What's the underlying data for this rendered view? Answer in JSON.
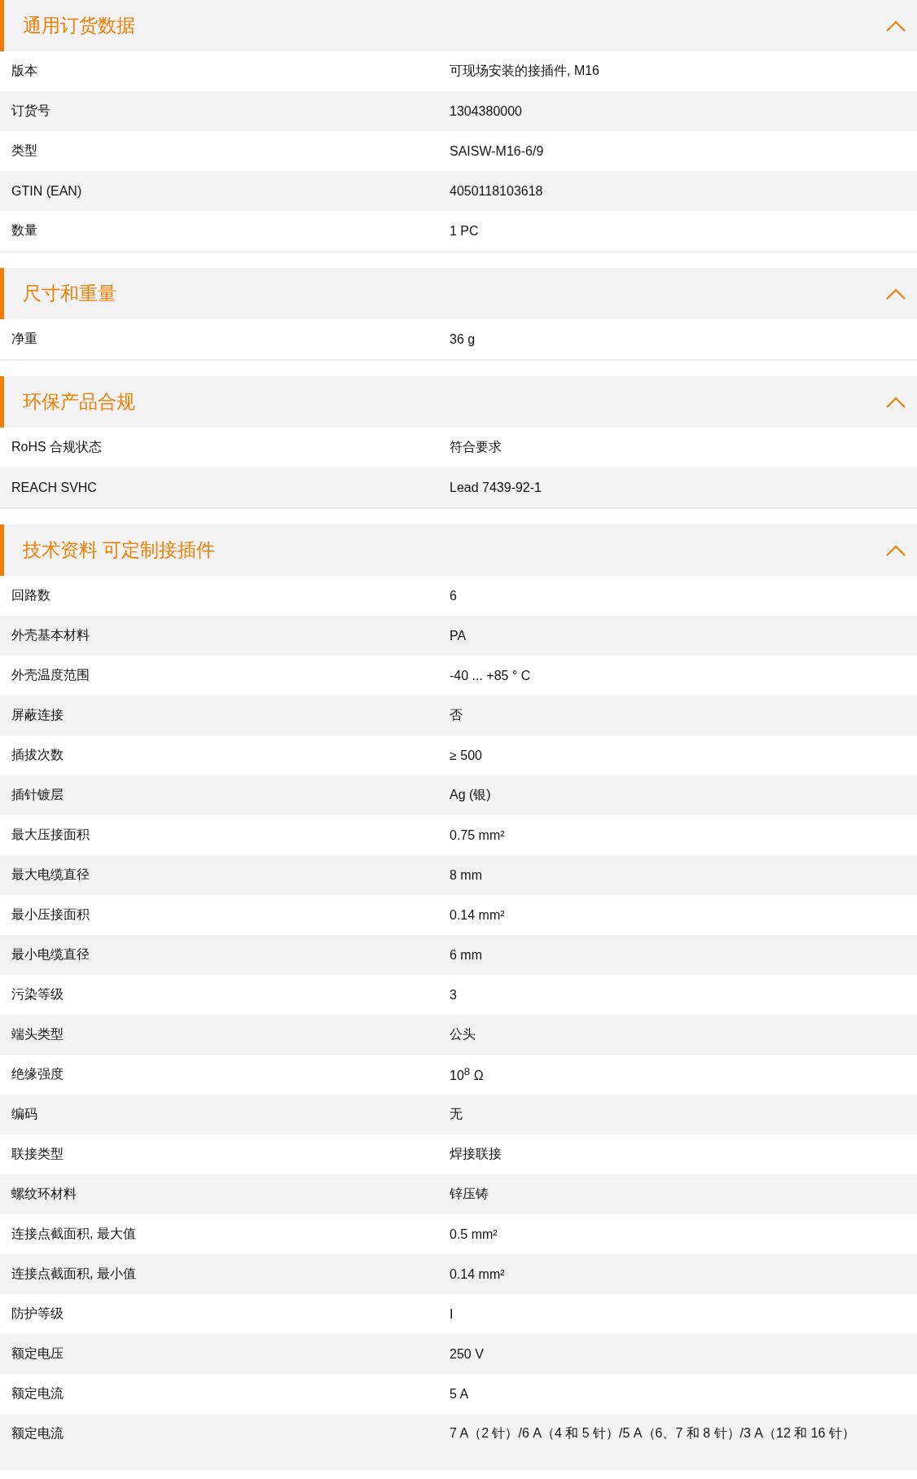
{
  "sections": [
    {
      "title": "通用订货数据",
      "expanded": true,
      "rows": [
        {
          "label": "版本",
          "value": "可现场安装的接插件, M16"
        },
        {
          "label": "订货号",
          "value": "1304380000"
        },
        {
          "label": "类型",
          "value": "SAISW-M16-6/9"
        },
        {
          "label": "GTIN (EAN)",
          "value": "4050118103618"
        },
        {
          "label": "数量",
          "value": "1  PC"
        }
      ]
    },
    {
      "title": "尺寸和重量",
      "expanded": true,
      "rows": [
        {
          "label": "净重",
          "value": "36  g"
        }
      ]
    },
    {
      "title": "环保产品合规",
      "expanded": true,
      "rows": [
        {
          "label": "RoHS 合规状态",
          "value": "符合要求"
        },
        {
          "label": "REACH SVHC",
          "value": "Lead 7439-92-1"
        }
      ]
    },
    {
      "title": "技术资料 可定制接插件",
      "expanded": true,
      "rows": [
        {
          "label": "回路数",
          "value": "6"
        },
        {
          "label": "外壳基本材料",
          "value": "PA"
        },
        {
          "label": "外壳温度范围",
          "value": "-40 ... +85 ° C"
        },
        {
          "label": "屏蔽连接",
          "value": "否"
        },
        {
          "label": "插拔次数",
          "value": "≥ 500"
        },
        {
          "label": "插针镀层",
          "value": "Ag (银)"
        },
        {
          "label": "最大压接面积",
          "value": "0.75  mm²"
        },
        {
          "label": "最大电缆直径",
          "value": "8  mm"
        },
        {
          "label": "最小压接面积",
          "value": "0.14  mm²"
        },
        {
          "label": "最小电缆直径",
          "value": "6  mm"
        },
        {
          "label": "污染等级",
          "value": "3"
        },
        {
          "label": "端头类型",
          "value": "公头"
        },
        {
          "label": "绝缘强度",
          "value": "10$^{8}$ Ω"
        },
        {
          "label": "编码",
          "value": "无"
        },
        {
          "label": "联接类型",
          "value": "焊接联接"
        },
        {
          "label": "螺纹环材料",
          "value": "锌压铸"
        },
        {
          "label": "连接点截面积, 最大值",
          "value": "0.5  mm²"
        },
        {
          "label": "连接点截面积, 最小值",
          "value": "0.14  mm²"
        },
        {
          "label": "防护等级",
          "value": "I"
        },
        {
          "label": "额定电压",
          "value": "250  V"
        },
        {
          "label": "额定电流",
          "value": "5  A"
        },
        {
          "label": "额定电流",
          "value": "7 A（2 针）/6 A（4 和 5 针）/5 A（6、7 和 8 针）/3 A（12 和 16 针）"
        }
      ]
    }
  ]
}
